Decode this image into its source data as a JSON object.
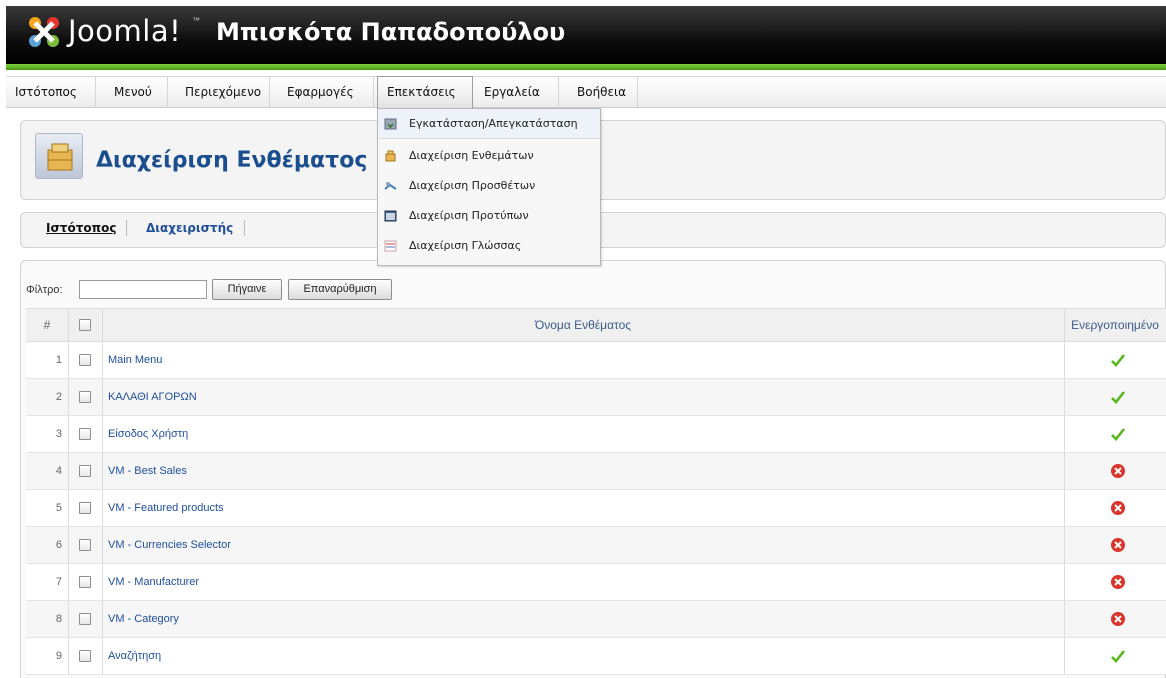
{
  "header": {
    "logo_text": "Joomla!",
    "logo_tm": "™",
    "site_name": "Μπισκότα Παπαδοπούλου"
  },
  "menu": {
    "items": [
      {
        "label": "Ιστότοπος"
      },
      {
        "label": "Μενού"
      },
      {
        "label": "Περιεχόμενο"
      },
      {
        "label": "Εφαρμογές"
      },
      {
        "label": "Επεκτάσεις",
        "active": true
      },
      {
        "label": "Εργαλεία"
      },
      {
        "label": "Βοήθεια"
      }
    ]
  },
  "dropdown": {
    "items": [
      {
        "label": "Εγκατάσταση/Απεγκατάσταση",
        "icon": "install-icon"
      },
      {
        "label": "Διαχείριση Ενθεμάτων",
        "icon": "module-icon"
      },
      {
        "label": "Διαχείριση Προσθέτων",
        "icon": "plugin-icon"
      },
      {
        "label": "Διαχείριση Προτύπων",
        "icon": "template-icon"
      },
      {
        "label": "Διαχείριση Γλώσσας",
        "icon": "language-icon"
      }
    ]
  },
  "page": {
    "title": "Διαχείριση Ενθέματος",
    "icon": "module-manager-icon"
  },
  "submenu": {
    "site": "Ιστότοπος",
    "admin": "Διαχειριστής"
  },
  "filter": {
    "label": "Φίλτρο:",
    "value": "",
    "go_label": "Πήγαινε",
    "reset_label": "Επαναρύθμιση"
  },
  "table": {
    "headers": {
      "num": "#",
      "name": "Όνομα Ενθέματος",
      "enabled": "Ενεργοποιημένο"
    },
    "rows": [
      {
        "num": "1",
        "name": "Main Menu",
        "enabled": true
      },
      {
        "num": "2",
        "name": "ΚΑΛΑΘΙ ΑΓΟΡΩΝ",
        "enabled": true
      },
      {
        "num": "3",
        "name": "Είσοδος Χρήστη",
        "enabled": true
      },
      {
        "num": "4",
        "name": "VM - Best Sales",
        "enabled": false
      },
      {
        "num": "5",
        "name": "VM - Featured products",
        "enabled": false
      },
      {
        "num": "6",
        "name": "VM - Currencies Selector",
        "enabled": false
      },
      {
        "num": "7",
        "name": "VM - Manufacturer",
        "enabled": false
      },
      {
        "num": "8",
        "name": "VM - Category",
        "enabled": false
      },
      {
        "num": "9",
        "name": "Αναζήτηση",
        "enabled": true
      }
    ]
  },
  "colors": {
    "accent_green": "#5db62a",
    "link_blue": "#1f4f9a",
    "title_blue": "#1b4e8f",
    "enabled_green": "#58b61e",
    "disabled_red": "#d9342b"
  }
}
